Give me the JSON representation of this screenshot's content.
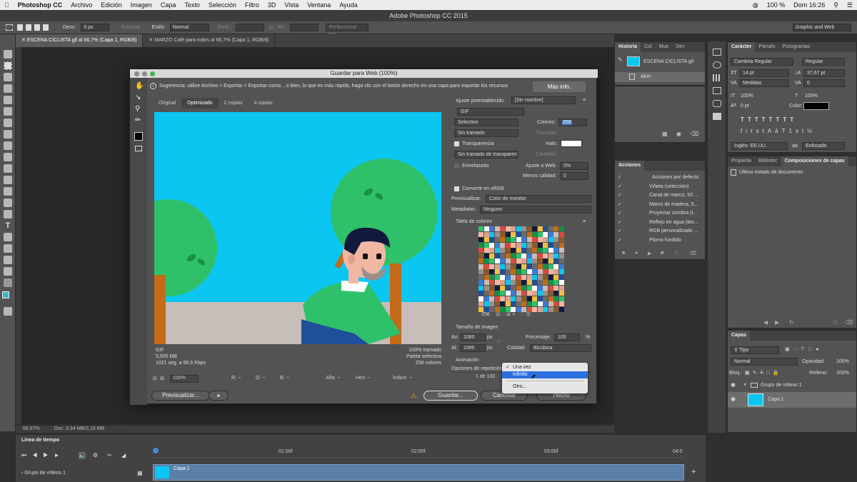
{
  "menubar": {
    "apple": "",
    "app": "Photoshop CC",
    "items": [
      "Archivo",
      "Edición",
      "Imagen",
      "Capa",
      "Texto",
      "Selección",
      "Filtro",
      "3D",
      "Vista",
      "Ventana",
      "Ayuda"
    ],
    "battery": "100 %",
    "clock": "Dom 16:26"
  },
  "window_title": "Adobe Photoshop CC 2015",
  "options_bar": {
    "desv_label": "Desv.:",
    "desv_value": "0 px",
    "suavizar": "Suavizar",
    "estilo_label": "Estilo:",
    "estilo_value": "Normal",
    "anch": "Anch.:",
    "alt": "Alt.:",
    "perfeccionar": "Perfeccionar bor.",
    "workspace": "Graphic and Web"
  },
  "doc_tabs": [
    {
      "label": "ESCENA CICLISTA gif al 66,7% (Capa 1, RGB/8)"
    },
    {
      "label": "MARZO Café para todos al 66,7% (Capa 1, RGB/8)"
    }
  ],
  "status": {
    "zoom": "66,67%",
    "doc": "Doc: 3,34 MB/3,16 MB"
  },
  "dialog": {
    "title": "Guardar para Web (100%)",
    "hint": "Sugerencia: utilice Archivo > Exportar > Exportar como... o bien, lo que es más rápido, haga clic con el botón derecho en una capa para exportar los recursos",
    "more_info": "Más info.",
    "view_tabs": [
      "Original",
      "Optimizado",
      "2 copias",
      "4 copias"
    ],
    "preview_info": {
      "left": [
        "GIF",
        "5,505 MB",
        "1021 seg. a 56,6 Kbps"
      ],
      "right": [
        "100% tramado",
        "Paleta selectiva",
        "256 colores"
      ]
    },
    "preset_label": "Ajuste preestablecido:",
    "preset_value": "[Sin nombre]",
    "format": "GIF",
    "reduction": "Selectivo",
    "colors_label": "Colores:",
    "colors_value": "256",
    "dither": "Sin tramado",
    "dither_amount": "Tramado:",
    "transparency": "Transparencia",
    "matte_label": "Halo:",
    "transp_dither": "Sin tramado de transparen",
    "amount_label": "Cantidad:",
    "interlaced": "Entrelazado",
    "web_snap_label": "Ajuste a Web:",
    "web_snap_value": "0%",
    "lossy_label": "Menos calidad:",
    "lossy_value": "0",
    "convert_srgb": "Convertir en sRGB",
    "preview_label": "Previsualizar:",
    "preview_value": "Color de monitor",
    "metadata_label": "Metadatos:",
    "metadata_value": "Ninguno",
    "color_table": "Tabla de colores",
    "palette_count": "256",
    "image_size": "Tamaño de imagen",
    "width_label": "An:",
    "width_value": "1080",
    "height_label": "Al:",
    "height_value": "1080",
    "unit": "px",
    "percent_label": "Porcentaje:",
    "percent_value": "100",
    "percent_unit": "%",
    "quality_label": "Calidad:",
    "quality_value": "Bicúbica",
    "animation": "Animación",
    "loop_label": "Opciones de repetición:",
    "frame_counter": "1 de 100",
    "zoom": "100%",
    "r": "R: --",
    "g": "G: --",
    "b": "B: --",
    "alpha": "Alfa: --",
    "hex": "Hex: --",
    "index": "Índice: --",
    "btn_preview": "Previsualizar...",
    "btn_save": "Guardar...",
    "btn_cancel": "Cancelar",
    "btn_done": "Hecho"
  },
  "dropdown": {
    "items": [
      "Una vez",
      "Infinito",
      "Otro..."
    ],
    "checked": "Una vez",
    "highlighted": "Infinito"
  },
  "history_panel": {
    "tabs": [
      "Historia",
      "Col",
      "Mue",
      "Dev"
    ],
    "snapshot": "ESCENA CICLISTA gif",
    "step": "Abrir"
  },
  "actions_panel": {
    "title": "Acciones",
    "items": [
      "Acciones por defecto",
      "Viñeta (selección)",
      "Canal de marco, 50 ...",
      "Marco de madera, 5...",
      "Proyectar sombra (t...",
      "Reflejo en agua (tex...",
      "RGB personalizado ...",
      "Plomo fundido"
    ]
  },
  "character_panel": {
    "tabs": [
      "Carácter",
      "Párrafo",
      "Pictogramas"
    ],
    "font": "Cambria Regular",
    "style": "Regular",
    "size": "14 pt",
    "leading": "37,67 pt",
    "kerning": "Medidas",
    "tracking": "0",
    "vscale": "100%",
    "hscale": "100%",
    "baseline": "0 pt",
    "color_label": "Color:",
    "language": "Inglés: EE.UU.",
    "aa": "Enfocado",
    "aa_glyph": "aa"
  },
  "props_panel": {
    "tabs": [
      "Propieda",
      "Bibliotec",
      "Composiciones de capas"
    ],
    "item": "Último estado de documento"
  },
  "layers_panel": {
    "title": "Capas",
    "filter": "Tipo",
    "blend": "Normal",
    "opacity_label": "Opacidad:",
    "opacity": "100%",
    "lock_label": "Bloq.:",
    "fill_label": "Relleno:",
    "fill": "100%",
    "group": "Grupo de vídeos 1",
    "layer": "Capa 1"
  },
  "timeline": {
    "title": "Línea de tiempo",
    "track": "Grupo de vídeos 1",
    "clip": "Capa 1",
    "ticks": [
      "01:00f",
      "02:00f",
      "03:00f",
      "04:0"
    ]
  },
  "colors": {
    "sky": "#0bc6f1",
    "tree": "#2fc16a",
    "ground": "#c7bdb9",
    "accent": "#2c6fde"
  }
}
